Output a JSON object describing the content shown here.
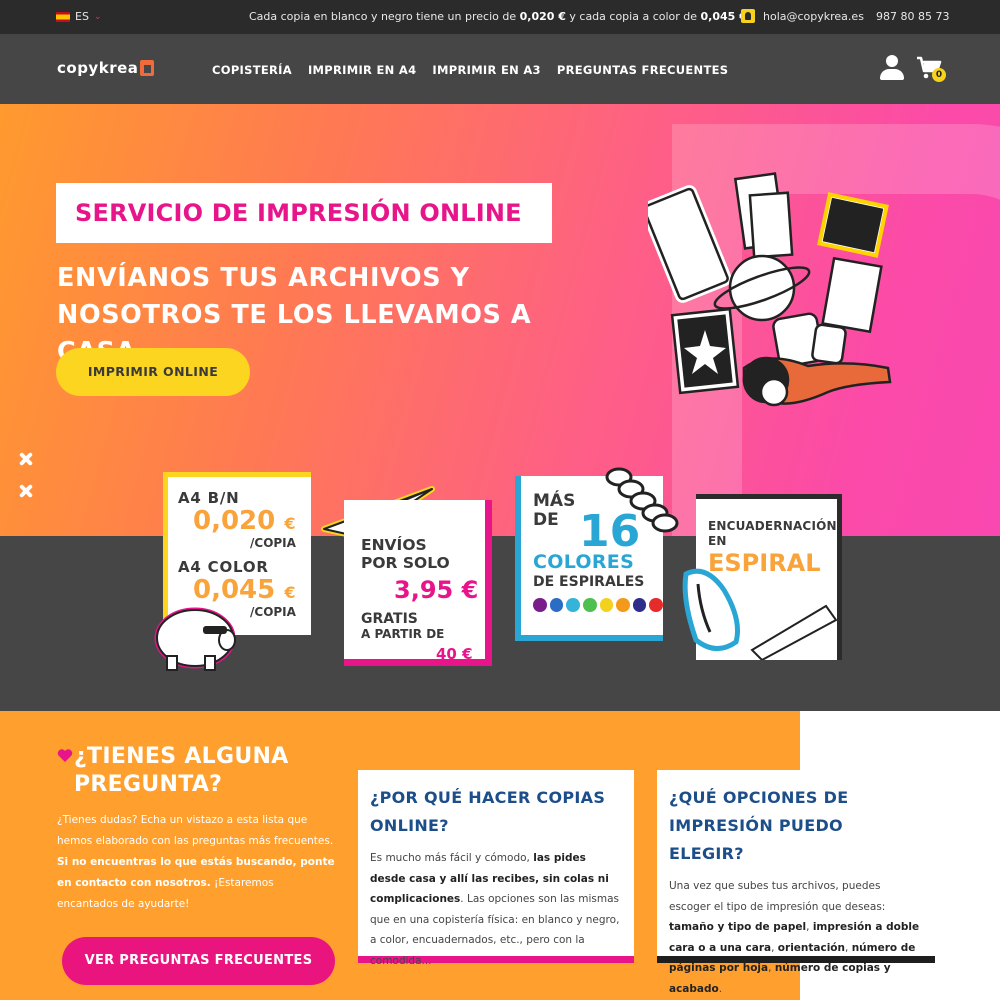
{
  "topbar": {
    "lang": "ES",
    "notice_pre": "Cada copia en blanco y negro tiene un precio de ",
    "notice_bw": "0,020 €",
    "notice_mid": " y cada copia a color de ",
    "notice_color": "0,045 €.",
    "email": "hola@copykrea.es",
    "phone": "987 80 85 73"
  },
  "header": {
    "logo": "copykrea",
    "nav": [
      "COPISTERÍA",
      "IMPRIMIR EN A4",
      "IMPRIMIR EN A3",
      "PREGUNTAS FRECUENTES"
    ],
    "cart_count": "0"
  },
  "hero": {
    "tag": "SERVICIO DE IMPRESIÓN ONLINE",
    "headline_1": "ENVÍANOS TUS ARCHIVOS Y",
    "headline_2": "NOSOTROS TE LOS LLEVAMOS A CASA",
    "cta": "IMPRIMIR ONLINE"
  },
  "promos": {
    "a4bw_label": "A4 B/N",
    "a4bw_price": "0,020",
    "a4color_label": "A4 COLOR",
    "a4color_price": "0,045",
    "currency": "€",
    "per_copy": "/COPIA",
    "shipping_1": "ENVÍOS",
    "shipping_2": "POR SOLO",
    "shipping_price": "3,95 €",
    "free_1": "GRATIS",
    "free_2": "A PARTIR DE",
    "free_amount": "40 €",
    "colors_1": "MÁS",
    "colors_2": "DE",
    "colors_num": "16",
    "colors_word": "COLORES",
    "colors_sub": "DE ESPIRALES",
    "spiral_colors": [
      "#7a1e8c",
      "#2b6cc4",
      "#35b3d8",
      "#4fbf4f",
      "#f2d21f",
      "#f39a1c",
      "#2e2e8a",
      "#e62b2b"
    ],
    "binding_1": "ENCUADERNACIÓN",
    "binding_2": "EN",
    "binding_3": "ESPIRAL"
  },
  "faq": {
    "title_1": "¿TIENES ALGUNA",
    "title_2": "PREGUNTA?",
    "text_1": "¿Tienes dudas? Echa un vistazo a esta lista que hemos elaborado con las preguntas más frecuentes. ",
    "text_bold": "Si no encuentras lo que estás buscando, ponte en contacto con nosotros.",
    "text_2": " ¡Estaremos encantados de ayudarte!",
    "button": "VER PREGUNTAS FRECUENTES",
    "q1_title": "¿POR QUÉ HACER COPIAS ONLINE?",
    "q1_a": "Es mucho más fácil y cómodo, ",
    "q1_b": "las pides desde casa y allí las recibes, sin colas ni complicaciones",
    "q1_c": ". Las opciones son las mismas que en una copistería física: en blanco y negro, a color, encuadernados, etc., pero con la comodida...",
    "q2_title": "¿QUÉ OPCIONES DE IMPRESIÓN PUEDO ELEGIR?",
    "q2_a": "Una vez que subes tus archivos, puedes escoger el tipo de impresión que deseas: ",
    "q2_b": "tamaño y tipo de papel",
    "q2_c": ", ",
    "q2_d": "impresión a doble cara o a una cara",
    "q2_e": ", ",
    "q2_f": "orientación",
    "q2_g": ", ",
    "q2_h": "número de páginas por hoja",
    "q2_i": ", ",
    "q2_j": "número de copias y acabado",
    "q2_k": "."
  }
}
